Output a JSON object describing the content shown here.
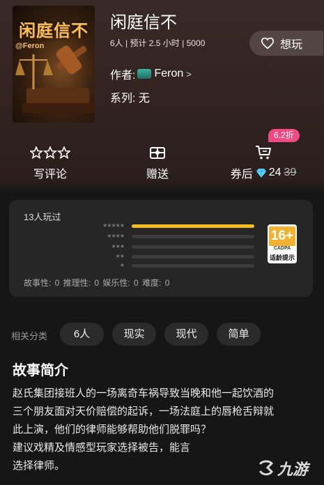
{
  "game": {
    "title": "闲庭信不",
    "meta": "6人 | 预计 2.5 小时 | 5000",
    "author_label": "作者:",
    "author_name": "Feron",
    "author_chevron": ">",
    "series": "系列: 无",
    "cover_title": "闲庭信不",
    "cover_subtitle": "@Feron"
  },
  "want_button": {
    "label": "想玩",
    "icon": "heart-outline-icon"
  },
  "actions": {
    "review": {
      "label": "写评论",
      "icon": "stars-icon"
    },
    "gift": {
      "label": "赠送",
      "icon": "gift-icon"
    },
    "buy": {
      "label": "券后",
      "icon": "cart-icon",
      "discount_badge": "6.2折",
      "price": "24",
      "original_price": "39",
      "currency_icon": "diamond-icon"
    }
  },
  "stats": {
    "played": "13人玩过",
    "rating_distribution": [
      {
        "stars": "★★★★★",
        "fraction": 1.0
      },
      {
        "stars": "★★★★",
        "fraction": 0
      },
      {
        "stars": "★★★",
        "fraction": 0
      },
      {
        "stars": "★★",
        "fraction": 0
      },
      {
        "stars": "★",
        "fraction": 0
      }
    ],
    "age_rating": {
      "value": "16+",
      "org": "CADPA",
      "tip": "适龄提示"
    },
    "scores": "故事性: 0   推理性: 0   娱乐性: 0   难度: 0"
  },
  "related": {
    "label": "相关分类",
    "tags": [
      "6人",
      "现实",
      "现代",
      "简单"
    ]
  },
  "synopsis": {
    "title": "故事简介",
    "lines": [
      "赵氏集团接班人的一场离奇车祸导致当晚和他一起饮酒的",
      "三个朋友面对天价赔偿的起诉，一场法庭上的唇枪舌辩就",
      "此上演，他们的律师能够帮助他们脱罪吗？",
      "建议戏精及情感型玩家选择被告，能言",
      "选择律师。"
    ]
  },
  "watermark": {
    "text": "九游"
  },
  "colors": {
    "accent_gold": "#f5bd1c",
    "badge_pink": "#f04a83",
    "diamond": "#58d6ff"
  }
}
